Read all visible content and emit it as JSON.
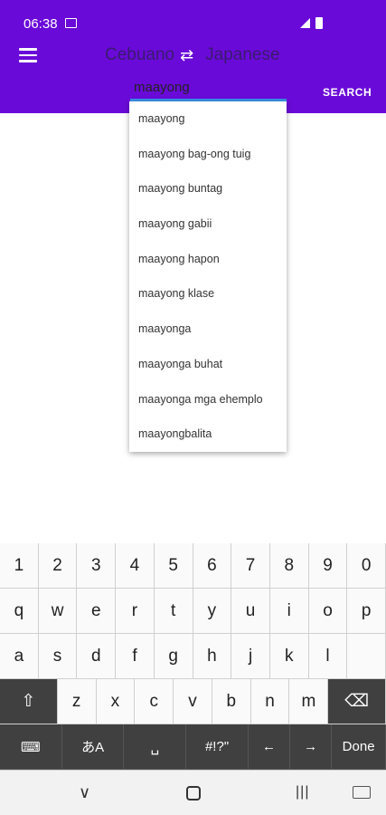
{
  "status_bar": {
    "time": "06:38"
  },
  "app_bar": {
    "source_language": "Cebuano",
    "target_language": "Japanese",
    "swap_glyph": "⇄",
    "search_value": "maayong",
    "search_button": "SEARCH"
  },
  "suggestions": [
    "maayong",
    "maayong bag-ong tuig",
    "maayong buntag",
    "maayong gabii",
    "maayong hapon",
    "maayong klase",
    "maayonga",
    "maayonga buhat",
    "maayonga mga ehemplo",
    "maayongbalita"
  ],
  "keyboard": {
    "row1": [
      "1",
      "2",
      "3",
      "4",
      "5",
      "6",
      "7",
      "8",
      "9",
      "0"
    ],
    "row2": [
      "q",
      "w",
      "e",
      "r",
      "t",
      "y",
      "u",
      "i",
      "o",
      "p"
    ],
    "row3": [
      "a",
      "s",
      "d",
      "f",
      "g",
      "h",
      "j",
      "k",
      "l"
    ],
    "row4": [
      "z",
      "x",
      "c",
      "v",
      "b",
      "n",
      "m"
    ],
    "shift": "⇧",
    "backspace": "⌫",
    "lang": "あA",
    "space": "␣",
    "symbols": "#!?\"",
    "left": "←",
    "right": "→",
    "done": "Done"
  },
  "nav": {
    "back": "∨",
    "recent": "|||"
  }
}
